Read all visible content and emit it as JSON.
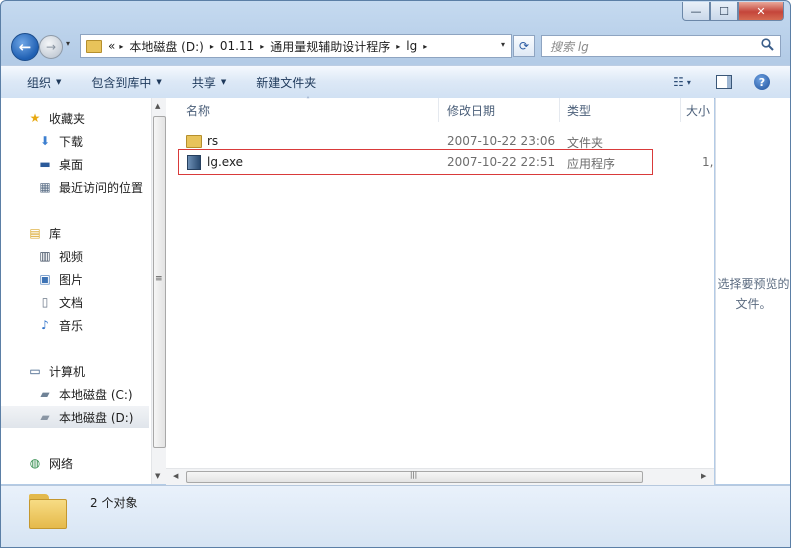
{
  "window": {
    "title": "",
    "buttons": {
      "minimize": "—",
      "maximize": "☐",
      "close": "✕"
    }
  },
  "navigation": {
    "back_glyph": "←",
    "forward_glyph": "→",
    "history_glyph": "▾",
    "address": {
      "overflow": "«",
      "crumbs": [
        "本地磁盘 (D:)",
        "01.11",
        "通用量规辅助设计程序",
        "lg"
      ],
      "separator": "▸",
      "dropdown": "▾"
    },
    "refresh_glyph": "⟳",
    "search": {
      "placeholder": "搜索 lg",
      "icon": "search-icon"
    }
  },
  "toolbar": {
    "organize": "组织",
    "include_in_library": "包含到库中",
    "share": "共享",
    "new_folder": "新建文件夹",
    "dropdown_glyph": "▼",
    "view_glyph": "☷",
    "view_drop": "▾",
    "help_glyph": "?"
  },
  "sidebar": {
    "groups": [
      {
        "label": "收藏夹",
        "icon": "star-icon",
        "glyph": "★",
        "color": "#e8a912",
        "items": [
          {
            "label": "下载",
            "icon": "download-icon",
            "glyph": "⬇",
            "color": "#3d7fd0"
          },
          {
            "label": "桌面",
            "icon": "desktop-icon",
            "glyph": "▬",
            "color": "#2b5a9a"
          },
          {
            "label": "最近访问的位置",
            "icon": "recent-places-icon",
            "glyph": "▦",
            "color": "#5a6e86"
          }
        ]
      },
      {
        "label": "库",
        "icon": "library-icon",
        "glyph": "▤",
        "color": "#d9a628",
        "items": [
          {
            "label": "视频",
            "icon": "video-icon",
            "glyph": "▥",
            "color": "#3b4a5e"
          },
          {
            "label": "图片",
            "icon": "pictures-icon",
            "glyph": "▣",
            "color": "#3d73b5"
          },
          {
            "label": "文档",
            "icon": "documents-icon",
            "glyph": "▯",
            "color": "#6b7788"
          },
          {
            "label": "音乐",
            "icon": "music-icon",
            "glyph": "♪",
            "color": "#2f72c9"
          }
        ]
      },
      {
        "label": "计算机",
        "icon": "computer-icon",
        "glyph": "▭",
        "color": "#34567f",
        "items": [
          {
            "label": "本地磁盘 (C:)",
            "icon": "system-drive-icon",
            "glyph": "▰",
            "color": "#6f8296"
          },
          {
            "label": "本地磁盘 (D:)",
            "icon": "drive-icon",
            "glyph": "▰",
            "color": "#8a96a4",
            "selected": true
          }
        ]
      },
      {
        "label": "网络",
        "icon": "network-icon",
        "glyph": "◍",
        "color": "#2f8a4a",
        "items": []
      }
    ]
  },
  "columns": {
    "name": "名称",
    "modified": "修改日期",
    "type": "类型",
    "size": "大小",
    "sort_glyph": "˄"
  },
  "files": [
    {
      "name": "rs",
      "modified": "2007-10-22 23:06",
      "type": "文件夹",
      "size": "",
      "icon": "folder-icon"
    },
    {
      "name": "lg.exe",
      "modified": "2007-10-22 22:51",
      "type": "应用程序",
      "size": "1,",
      "icon": "exe-icon",
      "highlighted": true
    }
  ],
  "scrollbar": {
    "up": "▲",
    "down": "▼",
    "left": "◀",
    "right": "▶",
    "grip": "≡",
    "hgrip": "|||"
  },
  "preview": {
    "message": "选择要预览的文件。"
  },
  "details": {
    "count": "2 个对象"
  }
}
